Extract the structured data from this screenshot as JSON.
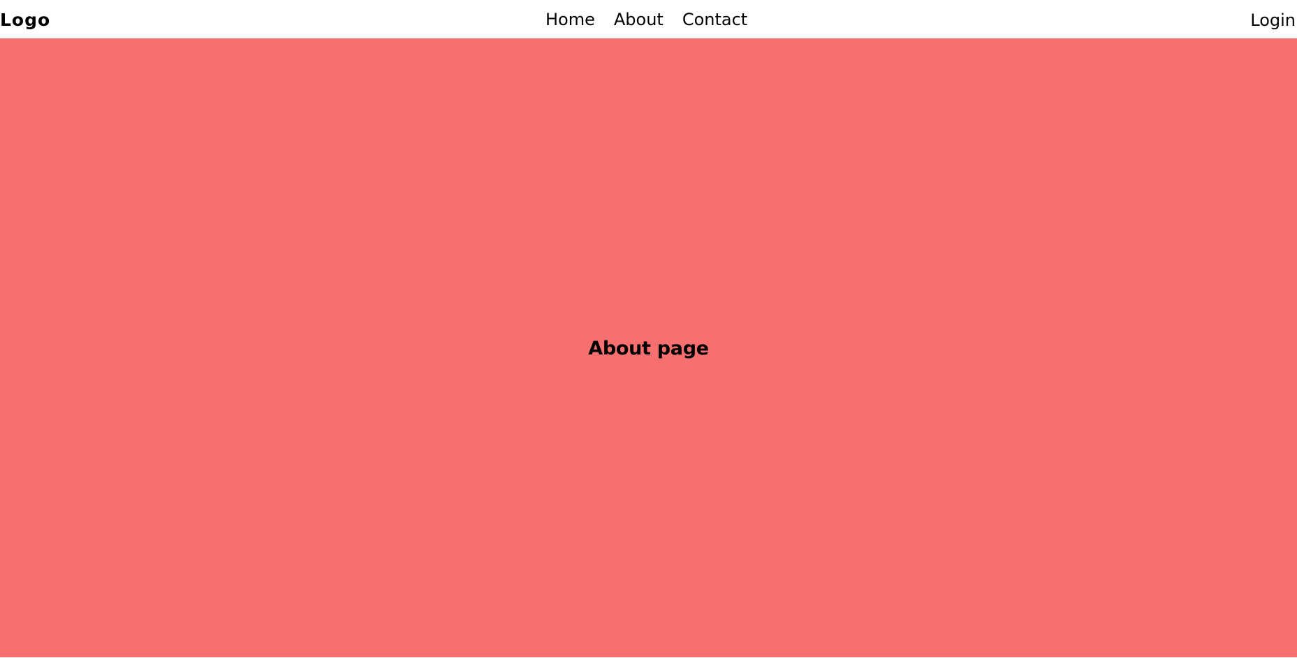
{
  "navbar": {
    "logo": "Logo",
    "links": [
      "Home",
      "About",
      "Contact"
    ],
    "login": "Login"
  },
  "hero": {
    "title": "About page"
  },
  "colors": {
    "hero_bg": "#f77070",
    "navbar_bg": "#ffffff",
    "text": "#000000"
  }
}
